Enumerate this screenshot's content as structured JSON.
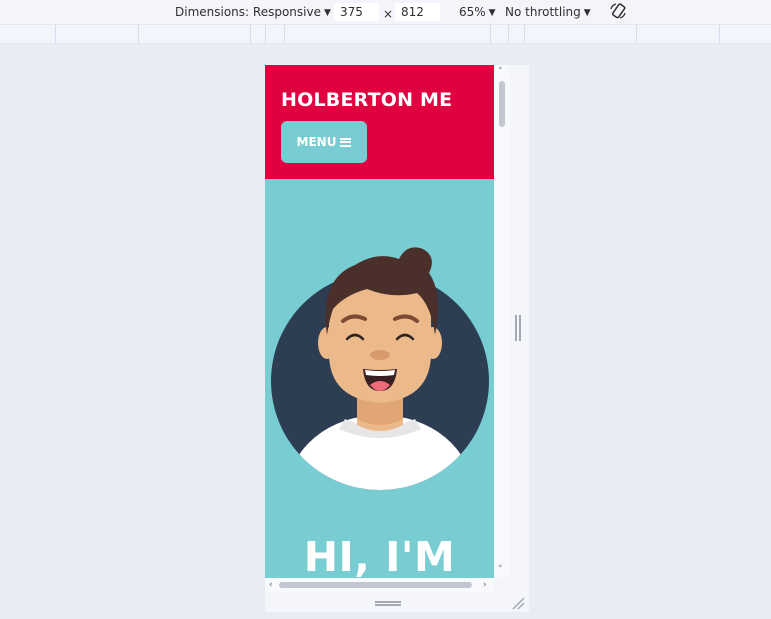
{
  "toolbar": {
    "dimensions_label": "Dimensions: Responsive",
    "width_value": "375",
    "times_symbol": "×",
    "height_value": "812",
    "zoom_label": "65%",
    "throttling_label": "No throttling",
    "rotate_icon": "rotate-icon"
  },
  "site": {
    "title": "HOLBERTON ME",
    "menu_label": "MENU",
    "menu_icon": "hamburger-icon",
    "hero_heading": "HI, I'M",
    "avatar_icon": "smiling-man-avatar"
  },
  "colors": {
    "header_bg": "#e10040",
    "hero_bg": "#78cdd2",
    "avatar_circle": "#2d3e53",
    "skin": "#ecb98a",
    "hair": "#4a2f2b"
  }
}
